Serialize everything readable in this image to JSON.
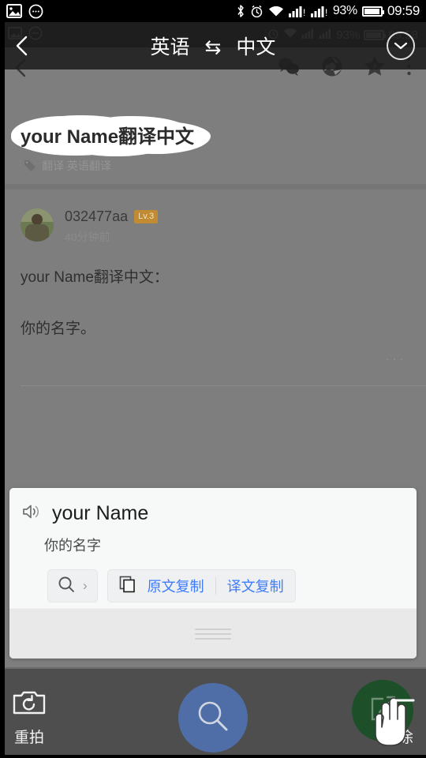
{
  "status_bar": {
    "icons_left": [
      "image-icon",
      "chat-bubble-icon"
    ],
    "icons_right": [
      "bluetooth-icon",
      "alarm-icon",
      "wifi-icon",
      "signal-1-icon",
      "signal-2-icon"
    ],
    "battery_percent": "93%",
    "clock": "09:59"
  },
  "translate_bar": {
    "back_icon": "back-chevron-icon",
    "source_language": "英语",
    "swap_icon": "⇆",
    "target_language": "中文",
    "collapse_icon": "chevron-down-icon"
  },
  "background_page": {
    "status_clock": "09:58",
    "status_battery": "93%",
    "back_icon": "back-chevron-icon",
    "actions": [
      "wechat-icon",
      "moments-icon",
      "star-icon",
      "more-icon"
    ],
    "question_title": "your Name翻译中文",
    "highlight_text": "your Name",
    "tag_icon": "tag-icon",
    "tags": "翻译 英语翻译",
    "answer": {
      "username": "032477aa",
      "level_badge": "Lv.3",
      "time": "40分钟前",
      "line1": "your Name翻译中文：",
      "line2": "你的名字。",
      "more_ellipsis": "···"
    }
  },
  "result_card": {
    "speaker_icon": "speaker-icon",
    "source_text": "your Name",
    "translated_text": "你的名字",
    "search_icon": "search-icon",
    "search_chevron": "›",
    "copy_icon": "copy-icon",
    "copy_source_label": "原文复制",
    "copy_target_label": "译文复制",
    "drag_handle_icon": "drag-handle-icon"
  },
  "bottom_bar": {
    "retake_icon": "camera-retake-icon",
    "retake_label": "重拍",
    "search_fab_icon": "search-icon",
    "repaint_icon": "edit-square-icon",
    "repaint_label": "重涂",
    "cursor_icon": "hand-pointer-icon"
  },
  "colors": {
    "accent_blue": "#3e7bfa",
    "fab_blue": "#4f6da6",
    "fab_green": "#1d5028",
    "level_badge": "#c08b33",
    "dim_overlay": "#7e7e7e"
  }
}
